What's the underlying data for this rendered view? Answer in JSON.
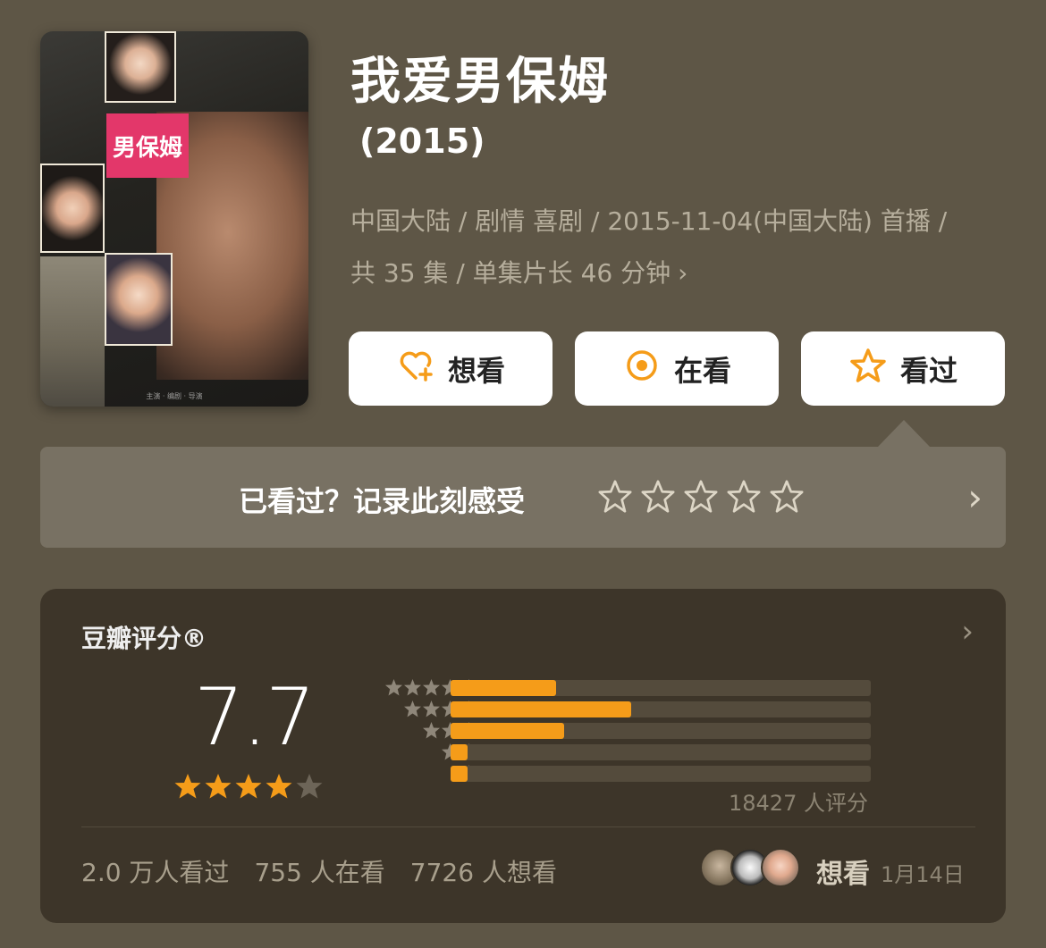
{
  "title": "我爱男保姆",
  "year": "(2015)",
  "meta_line1": "中国大陆 / 剧情 喜剧 / 2015-11-04(中国大陆) 首播 /",
  "meta_line2": "共 35 集 / 单集片长 46 分钟",
  "poster": {
    "logo_text": "男保姆",
    "credits": "主演 · 编剧 · 导演"
  },
  "actions": [
    {
      "label": "想看",
      "icon": "heart-plus-icon"
    },
    {
      "label": "在看",
      "icon": "target-circle-icon"
    },
    {
      "label": "看过",
      "icon": "star-outline-icon"
    }
  ],
  "record": {
    "prompt": "已看过？记录此刻感受",
    "stars": 5
  },
  "rating": {
    "label": "豆瓣评分®",
    "score": "7.7",
    "stars_filled": 4,
    "distribution": [
      {
        "stars": 5,
        "fraction": 0.25
      },
      {
        "stars": 4,
        "fraction": 0.43
      },
      {
        "stars": 3,
        "fraction": 0.27
      },
      {
        "stars": 2,
        "fraction": 0.04
      },
      {
        "stars": 1,
        "fraction": 0.04
      }
    ],
    "count": "18427 人评分",
    "watched": "2.0 万人看过",
    "watching": "755 人在看",
    "want": "7726 人想看",
    "friend_status": "想看",
    "friend_date": "1月14日"
  },
  "colors": {
    "accent": "#f59c19",
    "background": "#5e5646",
    "card": "#3d3529"
  }
}
